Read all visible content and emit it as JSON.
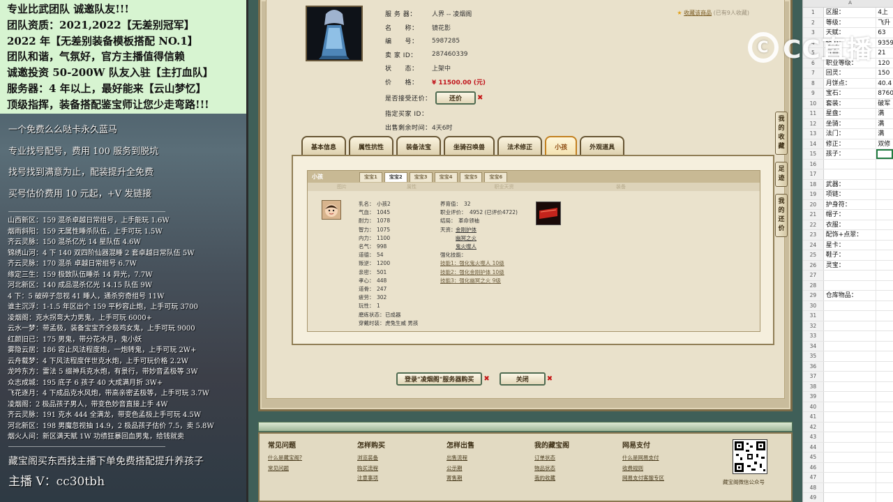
{
  "overlay": {
    "top_lines": [
      "专业比武团队 诚邀队友!!!",
      "团队资质：2021,2022【无差别冠军】",
      "2022 年【无差别装备模板搭配 NO.1】",
      "团队和谐，气氛好，官方主播值得信赖",
      "诚邀投资 50-200W 队友入驻【主打血队】",
      "服务器：4 年以上，最好能来【云山梦忆】",
      "顶级指挥，装备搭配鉴宝师让您少走弯路!!!"
    ],
    "mid_lines": [
      "一个免费么么哒卡永久蓝马",
      "专业找号配号，费用 100 服务到脱坑",
      "找号找到满意为止，配装提升全免费",
      "买号估价费用 10 元起，+V 发链接"
    ],
    "list_lines": [
      "山西新区：159 混杀卓越日常组号，上手能玩 1.6W",
      "烟雨斜阳：159 无属性睡杀队伍，上手可玩 1.5W",
      "齐云灵脉：150 混杀亿光 14 星队伍 4.6W",
      "锦绣山河：4 下 140 双四阶仙器混睡 2 套卓越日常队伍 5W",
      "齐云灵脉：170 混杀 卓越日常组号 6.7W",
      "缘定三生：159 极致队伍睡杀 14 异光，7.7W",
      "河北新区：140 成品混杀亿光 14.15 队伍 9W",
      "4 下：5 破碎子忽视 41 睡人，通杀穷奇组号 11W",
      "谁主沉浮：1-1.5 年区出个 159 平秒容止炮，上手可玩 3700",
      "凌烟阁：克水拐弯大力男鬼，上手可玩 6000+",
      "云水一梦：带孟极，装备宝宝齐全极鸡女鬼，上手可玩 9000",
      "红颜旧已：175 男鬼，带分花水月，鬼小妖",
      "雾隐云居：186 容止风法程度炮，一炮转鬼，上手可玩 2W+",
      "云舟载梦：4 下风法程度伴世克水炮，上手可玩价格 2.2W",
      "龙吟东方：雷法 5 缀神兵克水炮，有景行，带妙音孟极等 3W",
      "众志成城：195 底子 6 孩子 40 大成满月折 3W+",
      "飞花逐月：4 下成品克水风炮，带高亲密孟极等，上手可玩 3.7W",
      "凌烟阁：2 极品孩子男人，带变色妙音直接上手 4W",
      "齐云灵脉：191 克水 444 全满龙，带变色孟极上手可玩 4.5W",
      "河北新区：198 男魔忽视抽 14.9，2 极品孩子估价 7.5，卖 5.8W",
      "烟火人间：新区满天赋 1W 功绩狂暴回血男鬼，给钱就卖"
    ],
    "bottom_line1": "藏宝阁买东西找主播下单免费搭配提升养孩子",
    "bottom_line2": "主播 V：cc30tbh"
  },
  "item": {
    "rows": [
      {
        "label": "服 务 器：",
        "value": "人界 -- 凌烟阁"
      },
      {
        "label": "名　　称：",
        "value": "镜花影"
      },
      {
        "label": "编　　号：",
        "value": "5987285"
      },
      {
        "label": "卖 家 ID：",
        "value": "287460339"
      },
      {
        "label": "状　　态：",
        "value": "上架中"
      },
      {
        "label": "价　　格：",
        "value": "¥ 11500.00 (元)"
      }
    ],
    "bargain_label": "是否接受还价：",
    "bargain_button": "还价",
    "buyer_label": "指定买家 ID：",
    "buyer_value": "",
    "time_label": "出售剩余时间：",
    "time_value": "4天6时",
    "fav_text": "收藏该商品",
    "fav_count": "(已有9人收藏)"
  },
  "tabs": [
    "基本信息",
    "属性抗性",
    "装备法宝",
    "坐骑召唤兽",
    "法术修正",
    "小孩",
    "外观道具"
  ],
  "active_tab": 5,
  "child": {
    "section_label": "小孩",
    "sub_tabs": [
      "宝宝1",
      "宝宝2",
      "宝宝3",
      "宝宝4",
      "宝宝5",
      "宝宝6"
    ],
    "active_sub_tab": 1,
    "columns": [
      "图片",
      "属性",
      "职业天资",
      "装备"
    ],
    "attrs_left": [
      {
        "k": "乳名：",
        "v": "小孩2"
      },
      {
        "k": "气血：",
        "v": "1045"
      },
      {
        "k": "耐力：",
        "v": "1078"
      },
      {
        "k": "智力：",
        "v": "1075"
      },
      {
        "k": "内力：",
        "v": "1100"
      },
      {
        "k": "名气：",
        "v": "998"
      },
      {
        "k": "道德：",
        "v": "54"
      },
      {
        "k": "叛逆：",
        "v": "1200"
      },
      {
        "k": "亲密：",
        "v": "501"
      },
      {
        "k": "孝心：",
        "v": "448"
      },
      {
        "k": "道骨：",
        "v": "247"
      },
      {
        "k": "疲劳：",
        "v": "302"
      },
      {
        "k": "玩性：",
        "v": "1"
      },
      {
        "k": "磨练状态：",
        "v": "已成器"
      },
      {
        "k": "穿戴时装：",
        "v": "虎兔生威 男孩"
      }
    ],
    "attrs_right": {
      "age_label": "养育值：",
      "age_value": "32",
      "rating_label": "职业评价：",
      "rating_value": "4952 (已评价4722)",
      "result_label": "结局：",
      "result_value": "革命领袖",
      "talent_label": "天资：",
      "talents": [
        "金刚护体",
        "幽冥之火",
        "鬼火噬人"
      ],
      "skill_header": "强化技能：",
      "skills": [
        "技能1：强化鬼火噬人 10级",
        "技能2：强化金刚护体 10级",
        "技能3：强化幽冥之火 9级"
      ]
    }
  },
  "buttons": {
    "buy": "登录\"凌烟阁\"服务器购买",
    "close": "关闭"
  },
  "side_tabs": [
    "我的收藏",
    "足迹",
    "我的还价"
  ],
  "footer": [
    {
      "title": "常见问题",
      "links": [
        "什么是藏宝阁?",
        "常见问题"
      ]
    },
    {
      "title": "怎样购买",
      "links": [
        "浏览装备",
        "购买流程",
        "注意事项"
      ]
    },
    {
      "title": "怎样出售",
      "links": [
        "出售流程",
        "公示期",
        "寄售期"
      ]
    },
    {
      "title": "我的藏宝阁",
      "links": [
        "订单状态",
        "物品状态",
        "我的收藏"
      ]
    },
    {
      "title": "网易支付",
      "links": [
        "什么是网易支付",
        "收费规则",
        "网易支付客服专区"
      ]
    }
  ],
  "qr_label": "藏宝阁微信公众号",
  "sheet": {
    "col_a": "A",
    "rows": [
      {
        "n": "1",
        "a": "区服：",
        "b": "4上"
      },
      {
        "n": "2",
        "a": "等级：",
        "b": "飞升"
      },
      {
        "n": "3",
        "a": "天赋：",
        "b": "63"
      },
      {
        "n": "4",
        "a": "修为：",
        "b": "9359"
      },
      {
        "n": "5",
        "a": "气血：",
        "b": "21"
      },
      {
        "n": "6",
        "a": "职业等级：",
        "b": "120"
      },
      {
        "n": "7",
        "a": "回灵：",
        "b": "150"
      },
      {
        "n": "8",
        "a": "月饼点：",
        "b": "40.4"
      },
      {
        "n": "9",
        "a": "宝石：",
        "b": "8760"
      },
      {
        "n": "10",
        "a": "套装：",
        "b": "破军"
      },
      {
        "n": "11",
        "a": "星盘：",
        "b": "满"
      },
      {
        "n": "12",
        "a": "坐骑：",
        "b": "满"
      },
      {
        "n": "13",
        "a": "法门：",
        "b": "满"
      },
      {
        "n": "14",
        "a": "修正：",
        "b": "双修"
      },
      {
        "n": "15",
        "a": "孩子：",
        "b": ""
      },
      {
        "n": "16",
        "a": "",
        "b": ""
      },
      {
        "n": "17",
        "a": "",
        "b": ""
      },
      {
        "n": "18",
        "a": "武器：",
        "b": ""
      },
      {
        "n": "19",
        "a": "项链：",
        "b": ""
      },
      {
        "n": "20",
        "a": "护身符：",
        "b": ""
      },
      {
        "n": "21",
        "a": "帽子：",
        "b": ""
      },
      {
        "n": "22",
        "a": "衣服：",
        "b": ""
      },
      {
        "n": "23",
        "a": "配饰+点翠：",
        "b": ""
      },
      {
        "n": "24",
        "a": "星卡：",
        "b": ""
      },
      {
        "n": "25",
        "a": "鞋子：",
        "b": ""
      },
      {
        "n": "26",
        "a": "灵宝：",
        "b": ""
      },
      {
        "n": "27",
        "a": "",
        "b": ""
      },
      {
        "n": "28",
        "a": "",
        "b": ""
      },
      {
        "n": "29",
        "a": "仓库物品：",
        "b": ""
      },
      {
        "n": "30",
        "a": "",
        "b": ""
      },
      {
        "n": "31",
        "a": "",
        "b": ""
      },
      {
        "n": "32",
        "a": "",
        "b": ""
      },
      {
        "n": "33",
        "a": "",
        "b": ""
      },
      {
        "n": "34",
        "a": "",
        "b": ""
      },
      {
        "n": "35",
        "a": "",
        "b": ""
      },
      {
        "n": "36",
        "a": "",
        "b": ""
      },
      {
        "n": "37",
        "a": "",
        "b": ""
      },
      {
        "n": "38",
        "a": "",
        "b": ""
      },
      {
        "n": "39",
        "a": "",
        "b": ""
      },
      {
        "n": "40",
        "a": "",
        "b": ""
      },
      {
        "n": "41",
        "a": "",
        "b": ""
      },
      {
        "n": "42",
        "a": "",
        "b": ""
      },
      {
        "n": "43",
        "a": "",
        "b": ""
      },
      {
        "n": "44",
        "a": "",
        "b": ""
      },
      {
        "n": "45",
        "a": "",
        "b": ""
      },
      {
        "n": "46",
        "a": "",
        "b": ""
      },
      {
        "n": "47",
        "a": "",
        "b": ""
      },
      {
        "n": "48",
        "a": "",
        "b": ""
      },
      {
        "n": "49",
        "a": "",
        "b": ""
      }
    ],
    "selected_row": 14
  },
  "watermark": {
    "text": "CC直播"
  },
  "colors": {
    "accent": "#c0121a",
    "tab_active": "#c27f1e",
    "frame": "#3f5f58"
  }
}
